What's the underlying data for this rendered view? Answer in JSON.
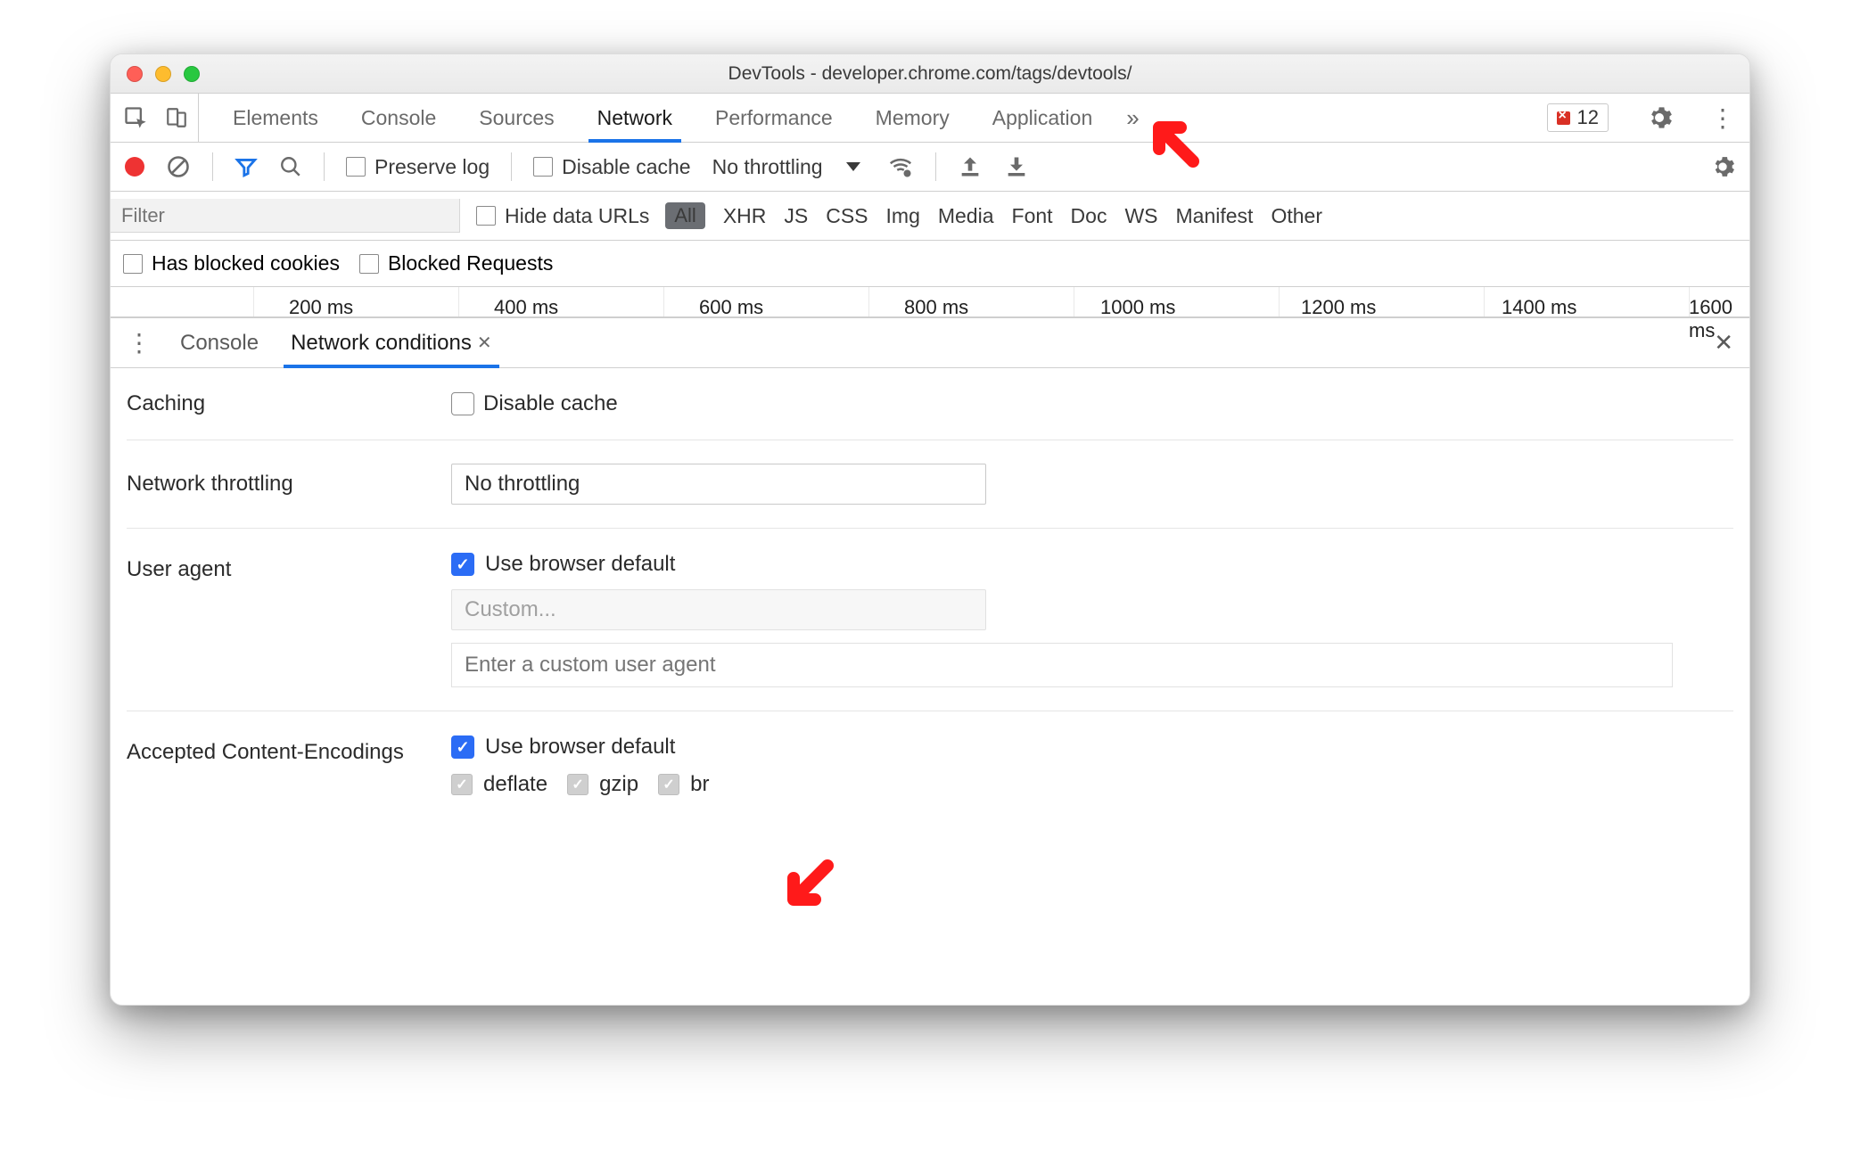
{
  "window": {
    "title": "DevTools - developer.chrome.com/tags/devtools/"
  },
  "tabs": {
    "items": [
      "Elements",
      "Console",
      "Sources",
      "Network",
      "Performance",
      "Memory",
      "Application"
    ],
    "active_index": 3,
    "overflow_glyph": "»",
    "error_count": "12"
  },
  "toolbar": {
    "preserve_log": "Preserve log",
    "disable_cache": "Disable cache",
    "throttle_value": "No throttling"
  },
  "filter": {
    "placeholder": "Filter",
    "hide_data_urls": "Hide data URLs",
    "categories": [
      "All",
      "XHR",
      "JS",
      "CSS",
      "Img",
      "Media",
      "Font",
      "Doc",
      "WS",
      "Manifest",
      "Other"
    ],
    "has_blocked_cookies": "Has blocked cookies",
    "blocked_requests": "Blocked Requests"
  },
  "timeline": {
    "ticks": [
      "200 ms",
      "400 ms",
      "600 ms",
      "800 ms",
      "1000 ms",
      "1200 ms",
      "1400 ms",
      "1600 ms"
    ]
  },
  "drawer": {
    "tabs": [
      "Console",
      "Network conditions"
    ],
    "active_index": 1,
    "panel": {
      "caching": {
        "label": "Caching",
        "disable_cache": "Disable cache"
      },
      "throttling": {
        "label": "Network throttling",
        "value": "No throttling"
      },
      "user_agent": {
        "label": "User agent",
        "use_default": "Use browser default",
        "custom_select": "Custom...",
        "custom_input_placeholder": "Enter a custom user agent"
      },
      "encodings": {
        "label": "Accepted Content-Encodings",
        "use_default": "Use browser default",
        "items": [
          "deflate",
          "gzip",
          "br"
        ]
      }
    }
  }
}
